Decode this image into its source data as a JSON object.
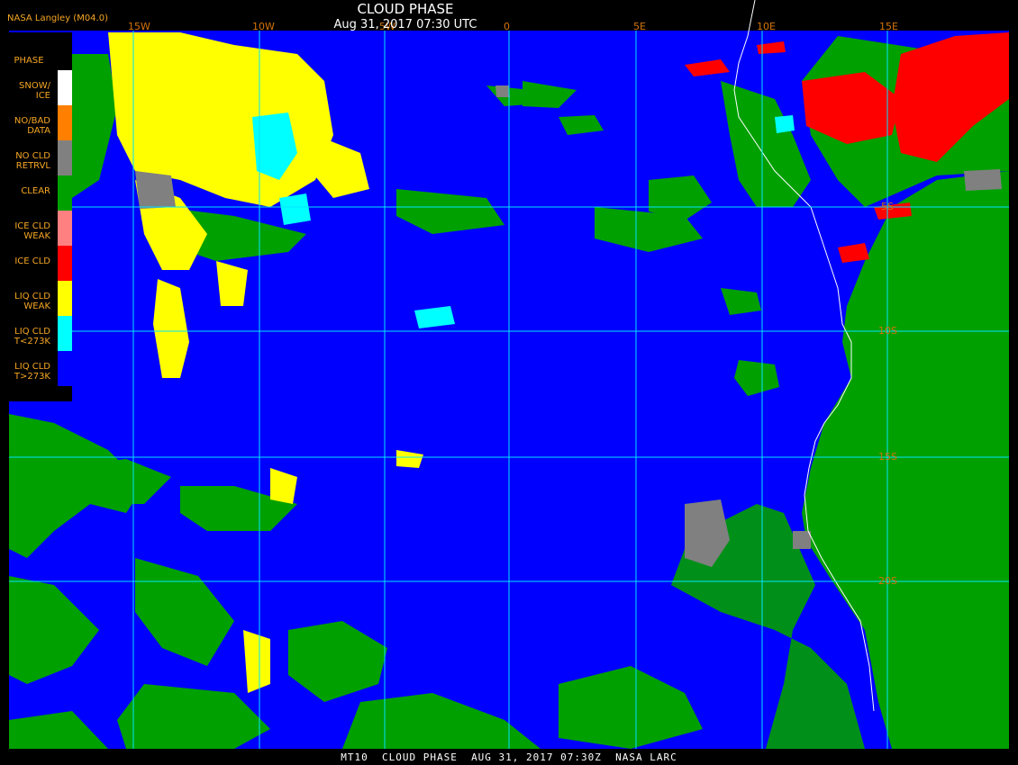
{
  "header": {
    "source": "NASA Langley (M04.0)",
    "title": "CLOUD PHASE",
    "subtitle": "Aug 31, 2017 07:30 UTC"
  },
  "legend": {
    "title": "PHASE",
    "items": [
      {
        "label": "SNOW/ ICE",
        "color": "#ffffff"
      },
      {
        "label": "NO/BAD DATA",
        "color": "#ff8000"
      },
      {
        "label": "NO CLD RETRVL",
        "color": "#808080"
      },
      {
        "label": "CLEAR",
        "color": "#00a000"
      },
      {
        "label": "ICE CLD WEAK",
        "color": "#ff8080"
      },
      {
        "label": "ICE CLD",
        "color": "#ff0000"
      },
      {
        "label": "LIQ CLD WEAK",
        "color": "#ffff00"
      },
      {
        "label": "LIQ CLD T<273K",
        "color": "#00ffff"
      },
      {
        "label": "LIQ CLD T>273K",
        "color": "#0000ff"
      }
    ]
  },
  "grid": {
    "longitudes": [
      "15W",
      "10W",
      "5W",
      "0",
      "5E",
      "10E",
      "15E"
    ],
    "latitudes": [
      "5S",
      "10S",
      "15S",
      "20S"
    ],
    "line_color": "#00e5ff"
  },
  "footer": "MT10  CLOUD PHASE  AUG 31, 2017 07:30Z  NASA LARC"
}
